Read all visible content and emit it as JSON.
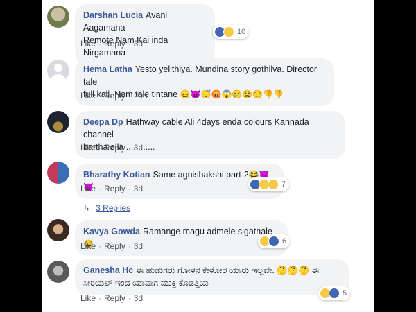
{
  "comments": [
    {
      "author": "Darshan Lucia",
      "text": "Avani Aagamana",
      "text2": "Remote Nam Kai inda Nirgamana",
      "emojis": "",
      "reaction_count": "10",
      "actions": {
        "like": "Like",
        "reply": "Reply",
        "time": "3d"
      }
    },
    {
      "author": "Hema Latha",
      "text": "Yesto yelithiya. Mundina story gothilva. Director tale",
      "text2": "full kali. Nam tale tintane",
      "emojis": "😖😈😴😡😱😢😫😒👎👎",
      "reaction_count": "",
      "actions": {
        "like": "Like",
        "reply": "Reply",
        "time": "20h"
      }
    },
    {
      "author": "Deepa Dp",
      "text": "Hathway cable Ali 4days enda colours Kannada channel",
      "text2": "bartha ella ............",
      "emojis": "",
      "reaction_count": "",
      "actions": {
        "like": "Like",
        "reply": "Reply",
        "time": "3d"
      }
    },
    {
      "author": "Bharathy Kotian",
      "text": "Same agnishakshi part-2",
      "text2": "",
      "emojis": "😂😈😈",
      "reaction_count": "7",
      "actions": {
        "like": "Like",
        "reply": "Reply",
        "time": "3d"
      }
    },
    {
      "author": "Kavya Gowda",
      "text": "Ramange magu admele sigathale",
      "text2": "",
      "emojis": "😂",
      "reaction_count": "6",
      "actions": {
        "like": "Like",
        "reply": "Reply",
        "time": "3d"
      }
    },
    {
      "author": "Ganesha Hc",
      "text": "ಈ ಹುಡುಗರು ಗೋಳನ ಕೇಳೋರ ಯಾರು ಇಲ್ಲವೇ. 🤔🤔🤔 ಈ",
      "text2": "ಸೀರಿಯಲ್ ಇಂದ ಯಾವಾಗ ಮುಕ್ತಿ ಕೊಡತ್ತಿಯ",
      "emojis": "",
      "reaction_count": "5",
      "actions": {
        "like": "Like",
        "reply": "Reply",
        "time": "3d"
      }
    }
  ],
  "replies_link": "3 Replies",
  "colors": {
    "author": "#385898",
    "bubble": "#f2f3f5",
    "like": "#4267b2"
  }
}
